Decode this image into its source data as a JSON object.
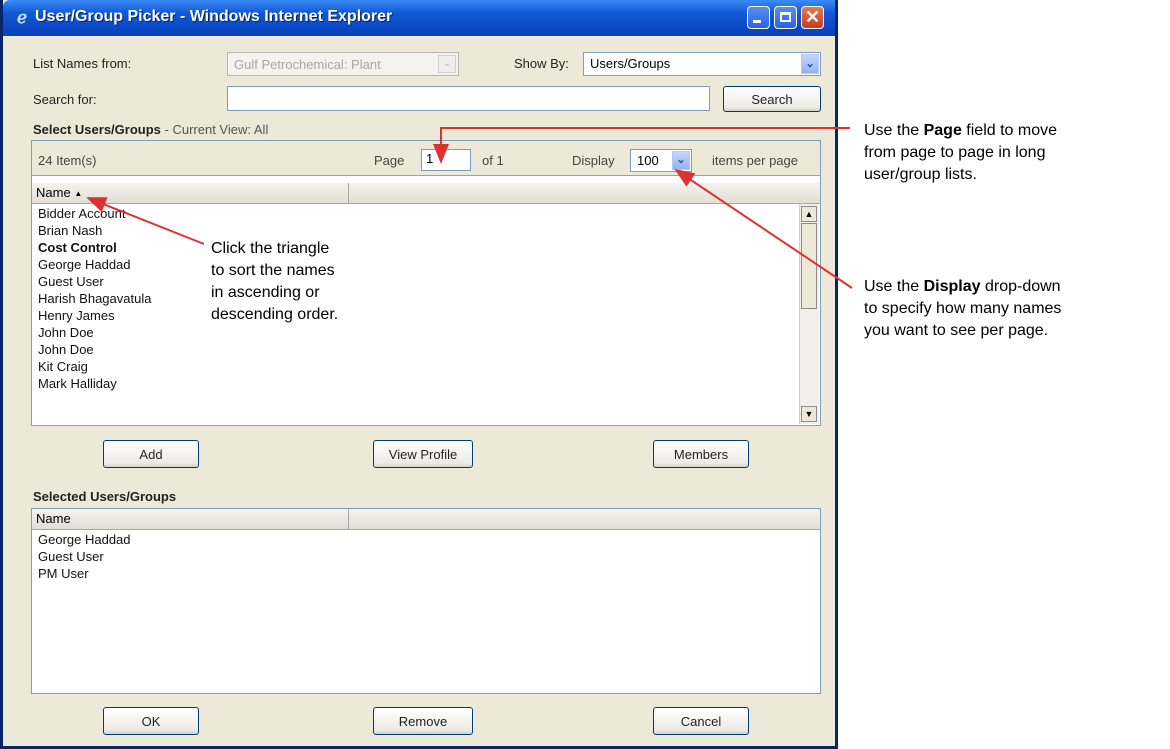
{
  "window": {
    "title": "User/Group Picker - Windows Internet Explorer"
  },
  "filters": {
    "list_names_label": "List Names from:",
    "list_names_value": "Gulf Petrochemical: Plant",
    "show_by_label": "Show By:",
    "show_by_value": "Users/Groups",
    "search_label": "Search for:",
    "search_value": "",
    "search_button": "Search"
  },
  "select_section": {
    "title": "Select Users/Groups",
    "view_prefix": "- Current View:",
    "view_value": "All",
    "item_count": "24 Item(s)",
    "page_label": "Page",
    "page_value": "1",
    "page_of": "of 1",
    "display_label": "Display",
    "display_value": "100",
    "per_page_label": "items per page",
    "column_name": "Name",
    "rows": [
      "Bidder Account",
      "Brian Nash",
      "Cost Control",
      "George Haddad",
      "Guest User",
      "Harish Bhagavatula",
      "Henry James",
      "John Doe",
      "John Doe",
      "Kit Craig",
      "Mark Halliday"
    ]
  },
  "actions": {
    "add": "Add",
    "view_profile": "View Profile",
    "members": "Members"
  },
  "selected_section": {
    "title": "Selected Users/Groups",
    "column_name": "Name",
    "rows": [
      "George Haddad",
      "Guest User",
      "PM User"
    ]
  },
  "footer": {
    "ok": "OK",
    "remove": "Remove",
    "cancel": "Cancel"
  },
  "annotations": {
    "sort_line1": "Click the triangle",
    "sort_line2": "to sort the names",
    "sort_line3": "in ascending or",
    "sort_line4": "descending order.",
    "page_pre": "Use the",
    "page_bold": "Page",
    "page_post": "field to move",
    "page_line2": "from page to page in long",
    "page_line3": "user/group lists.",
    "display_pre": "Use the",
    "display_bold": "Display",
    "display_post": "drop-down",
    "display_line2": "to specify how many names",
    "display_line3": "you want to see per page."
  },
  "colors": {
    "title_bar": "#0a47c4",
    "dialog_bg": "#ece9d8",
    "annotation_arrow": "#e03030"
  }
}
